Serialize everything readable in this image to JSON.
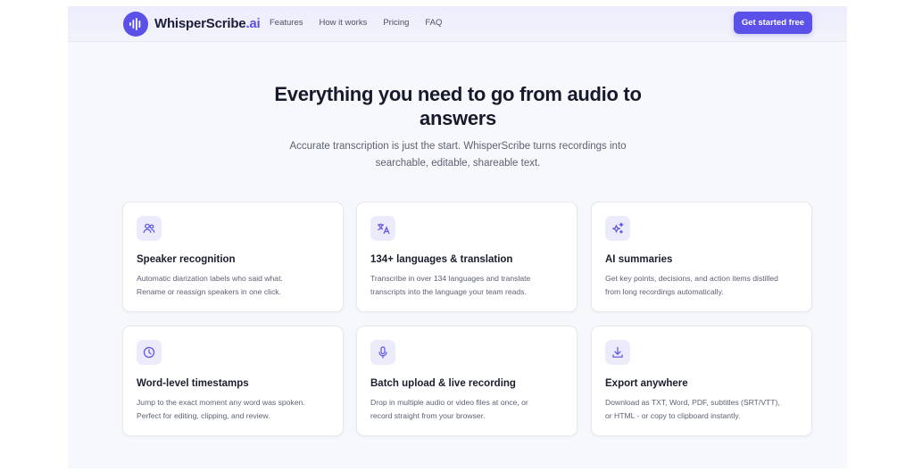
{
  "brand": {
    "name": "WhisperScribe",
    "suffix": ".ai",
    "accent": "#5b50e8",
    "logo_icon": "waveform-icon"
  },
  "nav": {
    "links": [
      "Features",
      "How it works",
      "Pricing",
      "FAQ"
    ],
    "cta_label": "Get started free"
  },
  "hero": {
    "title_line1": "Everything you need to go from audio to",
    "title_line2": "answers",
    "subtitle_line1": "Accurate transcription is just the start. WhisperScribe turns recordings into",
    "subtitle_line2": "searchable, editable, shareable text."
  },
  "features": [
    {
      "icon": "users-icon",
      "title": "Speaker recognition",
      "desc_line1": "Automatic diarization labels who said what.",
      "desc_line2": "Rename or reassign speakers in one click."
    },
    {
      "icon": "translate-icon",
      "title": "134+ languages & translation",
      "desc_line1": "Transcribe in over 134 languages and translate",
      "desc_line2": "transcripts into the language your team reads."
    },
    {
      "icon": "sparkles-icon",
      "title": "AI summaries",
      "desc_line1": "Get key points, decisions, and action items distilled",
      "desc_line2": "from long recordings automatically."
    },
    {
      "icon": "clock-icon",
      "title": "Word-level timestamps",
      "desc_line1": "Jump to the exact moment any word was spoken.",
      "desc_line2": "Perfect for editing, clipping, and review."
    },
    {
      "icon": "microphone-icon",
      "title": "Batch upload & live recording",
      "desc_line1": "Drop in multiple audio or video files at once, or",
      "desc_line2": "record straight from your browser."
    },
    {
      "icon": "download-icon",
      "title": "Export anywhere",
      "desc_line1": "Download as TXT, Word, PDF, subtitles (SRT/VTT),",
      "desc_line2": "or HTML - or copy to clipboard instantly."
    }
  ]
}
